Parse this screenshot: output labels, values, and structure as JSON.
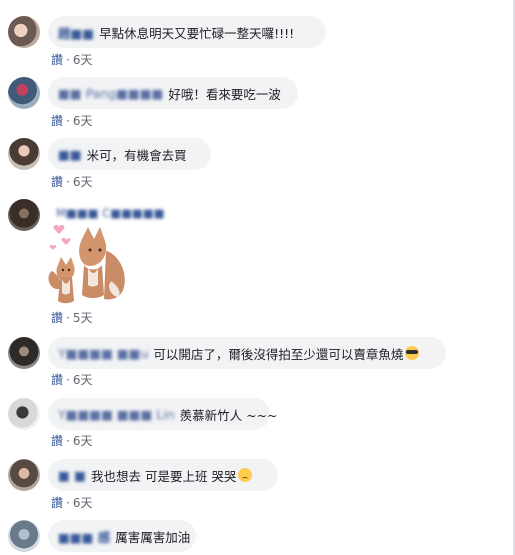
{
  "comments": [
    {
      "name": "趙■■",
      "text": "早點休息明天又要忙碌一整天囉!!!!",
      "like": "讚",
      "time": "6天"
    },
    {
      "name": "■■ Pang■■■■",
      "text": "好哦！看來要吃一波",
      "like": "讚",
      "time": "6天"
    },
    {
      "name": "■■",
      "text": "米可，有機會去買",
      "like": "讚",
      "time": "6天"
    },
    {
      "name": "M■■■ C■■■■■",
      "sticker": "fox-hearts-sticker",
      "like": "讚",
      "time": "5天"
    },
    {
      "name": "Y■■■■ ■■u",
      "text": "可以開店了，爾後沒得拍至少還可以賣章魚燒",
      "emoji": "sunglasses-emoji",
      "like": "讚",
      "time": "6天"
    },
    {
      "name": "Y■■■■ ■■■ Lin",
      "text": "羨慕新竹人 ~~~",
      "like": "讚",
      "time": "6天"
    },
    {
      "name": "■ ■",
      "text": "我也想去 可是要上班 哭哭",
      "emoji": "worried-face-emoji",
      "like": "讚",
      "time": "6天"
    },
    {
      "name": "■■■ 感",
      "text": "厲害厲害加油"
    }
  ],
  "colors": {
    "name": "#385898",
    "bubble": "#f2f3f5",
    "meta": "#606770"
  }
}
